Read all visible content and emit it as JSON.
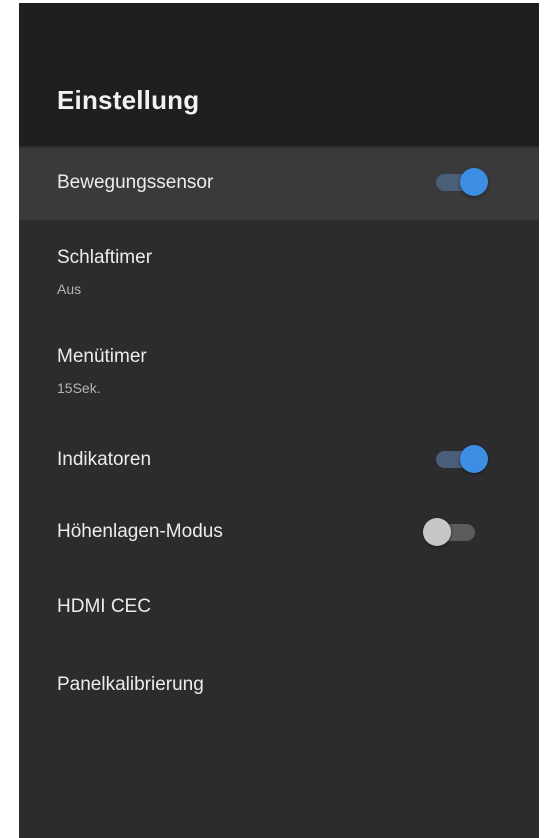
{
  "header": {
    "title": "Einstellung"
  },
  "settings": {
    "items": [
      {
        "label": "Bewegungssensor",
        "toggle": "on"
      },
      {
        "label": "Schlaftimer",
        "value": "Aus"
      },
      {
        "label": "Menütimer",
        "value": "15Sek."
      },
      {
        "label": "Indikatoren",
        "toggle": "on"
      },
      {
        "label": "Höhenlagen-Modus",
        "toggle": "off"
      },
      {
        "label": "HDMI CEC"
      },
      {
        "label": "Panelkalibrierung"
      }
    ]
  },
  "colors": {
    "panel_background": "#2c2c2e",
    "header_background": "#1f1f21",
    "selected_row": "#3a3a3c",
    "toggle_on_thumb": "#3c8ee3",
    "toggle_on_track": "#4a5d79",
    "toggle_off_thumb": "#c7c7c7",
    "toggle_off_track": "#5b5b5b"
  }
}
